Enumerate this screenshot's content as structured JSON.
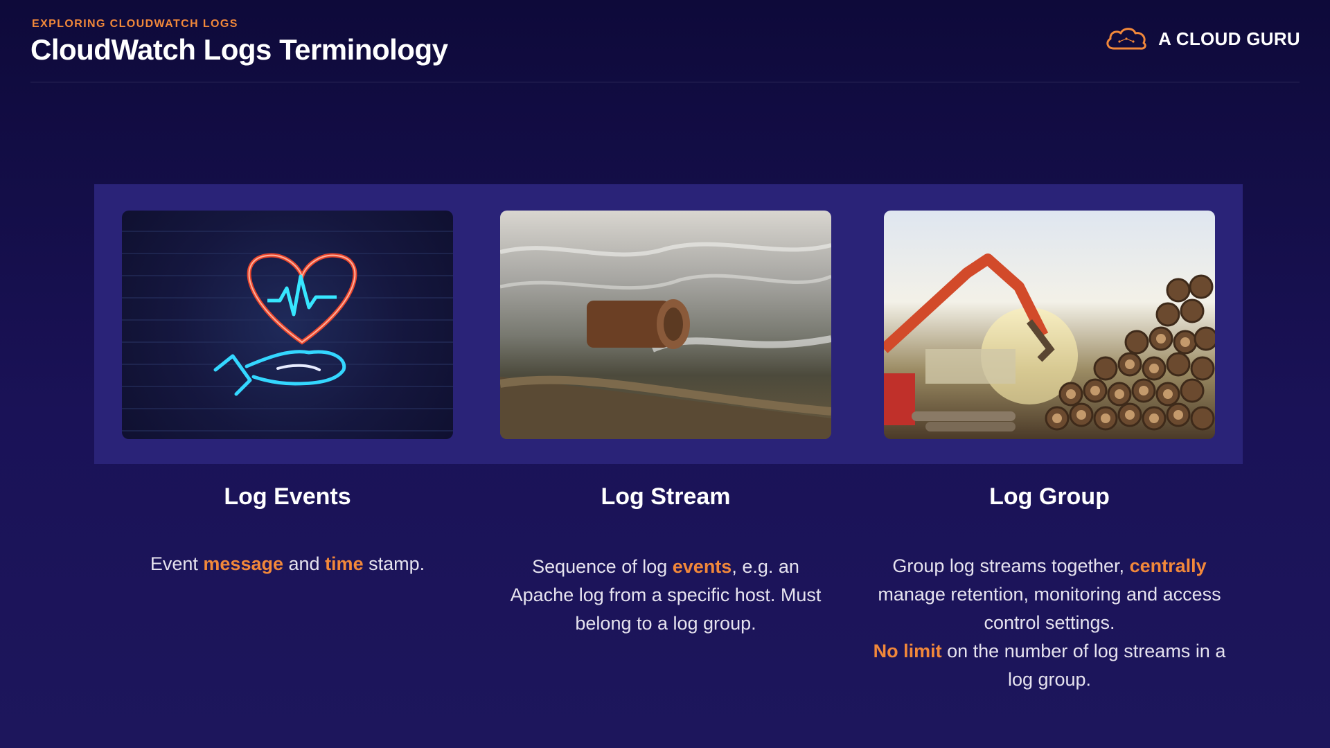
{
  "header": {
    "eyebrow": "EXPLORING CLOUDWATCH LOGS",
    "title": "CloudWatch Logs Terminology",
    "brand": "A CLOUD GURU"
  },
  "colors": {
    "accent": "#f2883a",
    "background": "#1a1257",
    "panel": "#2a2378"
  },
  "icons": {
    "brand": "cloud-logo-icon"
  },
  "columns": [
    {
      "title": "Log Events",
      "image": "neon heart and hand sign on brick wall",
      "text": {
        "p1": "Event ",
        "h1": "message",
        "p2": " and ",
        "h2": "time",
        "p3": " stamp."
      }
    },
    {
      "title": "Log Stream",
      "image": "log floating in river stream",
      "text": {
        "p1": "Sequence of log ",
        "h1": "events",
        "p2": ", e.g. an Apache log from a specific host. Must belong to a log group."
      }
    },
    {
      "title": "Log Group",
      "image": "excavator next to a pile of logs",
      "text": {
        "p1": "Group log streams together, ",
        "h1": "centrally",
        "p2": " manage retention, monitoring and access control settings.",
        "h2": "No limit",
        "p3": " on the number of log streams in a log group."
      }
    }
  ]
}
